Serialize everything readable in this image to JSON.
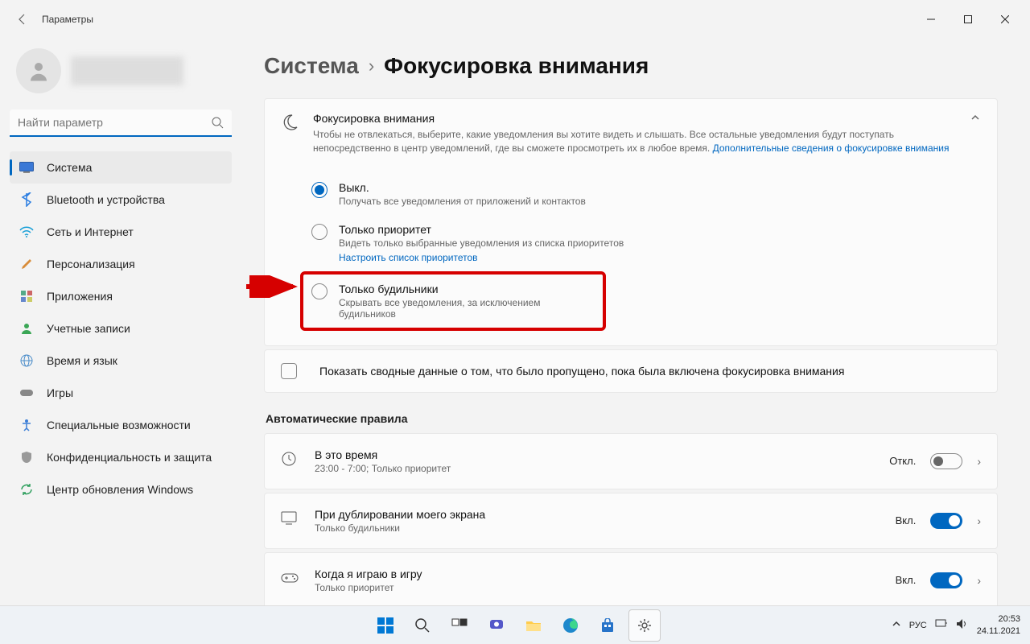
{
  "titlebar": {
    "app_title": "Параметры"
  },
  "sidebar": {
    "search_placeholder": "Найти параметр",
    "items": [
      {
        "label": "Система"
      },
      {
        "label": "Bluetooth и устройства"
      },
      {
        "label": "Сеть и Интернет"
      },
      {
        "label": "Персонализация"
      },
      {
        "label": "Приложения"
      },
      {
        "label": "Учетные записи"
      },
      {
        "label": "Время и язык"
      },
      {
        "label": "Игры"
      },
      {
        "label": "Специальные возможности"
      },
      {
        "label": "Конфиденциальность и защита"
      },
      {
        "label": "Центр обновления Windows"
      }
    ]
  },
  "breadcrumb": {
    "parent": "Система",
    "current": "Фокусировка внимания"
  },
  "focus": {
    "title": "Фокусировка внимания",
    "desc": "Чтобы не отвлекаться, выберите, какие уведомления вы хотите видеть и слышать. Все остальные уведомления будут поступать непосредственно в центр уведомлений, где вы сможете просмотреть их в любое время.  ",
    "learn_more": "Дополнительные сведения о фокусировке внимания",
    "options": [
      {
        "title": "Выкл.",
        "desc": "Получать все уведомления от приложений и контактов"
      },
      {
        "title": "Только приоритет",
        "desc": "Видеть только выбранные уведомления из списка приоритетов",
        "link": "Настроить список приоритетов"
      },
      {
        "title": "Только будильники",
        "desc": "Скрывать все уведомления, за исключением будильников"
      }
    ],
    "summary_checkbox": "Показать сводные данные о том, что было пропущено, пока была включена фокусировка внимания"
  },
  "rules": {
    "section_title": "Автоматические правила",
    "items": [
      {
        "title": "В это время",
        "desc": "23:00 - 7:00; Только приоритет",
        "state": "Откл.",
        "on": false
      },
      {
        "title": "При дублировании моего экрана",
        "desc": "Только будильники",
        "state": "Вкл.",
        "on": true
      },
      {
        "title": "Когда я играю в игру",
        "desc": "Только приоритет",
        "state": "Вкл.",
        "on": true
      }
    ]
  },
  "tray": {
    "lang": "РУС",
    "time": "20:53",
    "date": "24.11.2021"
  }
}
